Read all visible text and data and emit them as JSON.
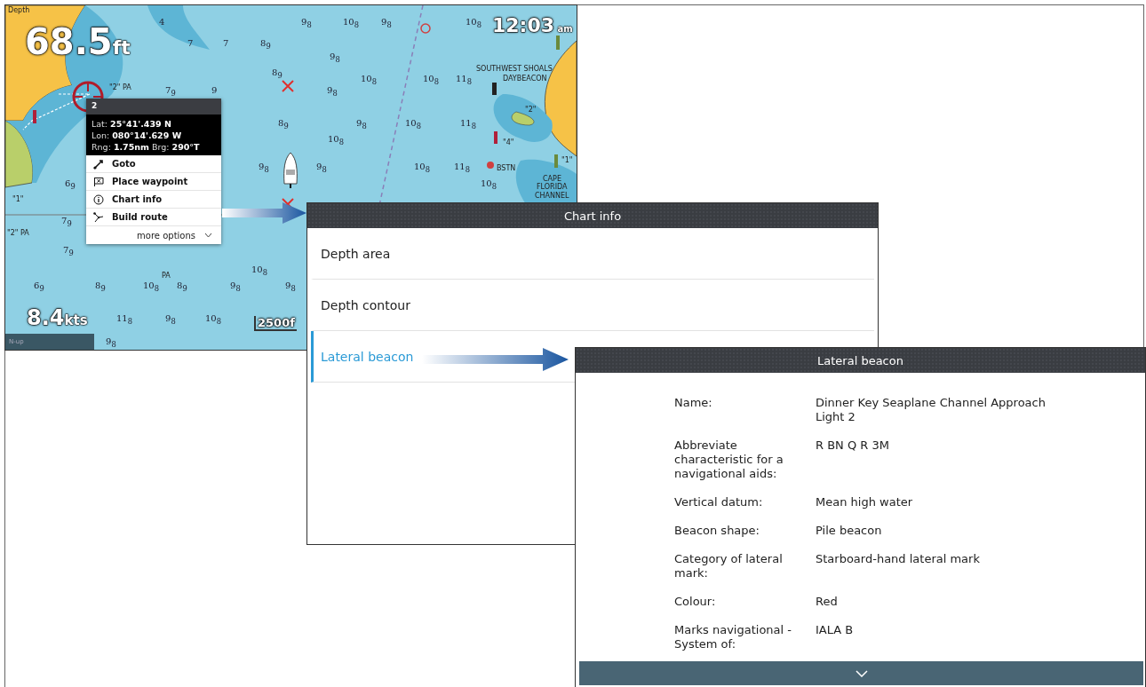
{
  "chart": {
    "depth_label": "Depth",
    "depth": "68.5",
    "depth_unit": "ft",
    "time": "12:03",
    "time_suffix": "am",
    "speed": "8.4",
    "speed_unit": "kts",
    "scale": "2500f",
    "orientation": "N-up",
    "soundings": [
      "4",
      "9$_{8}$",
      "10$_{8}$",
      "9$_{8}$",
      "10$_{8}$",
      "7",
      "7",
      "8$_{9}$",
      "9$_{8}$",
      "8$_{9}$",
      "10$_{8}$",
      "10$_{8}$",
      "11$_{8}$",
      "7$_{9}$",
      "9",
      "9$_{8}$",
      "8$_{9}$",
      "9$_{8}$",
      "10$_{8}$",
      "11$_{8}$",
      "10$_{8}$",
      "9$_{8}$",
      "9$_{8}$",
      "10$_{8}$",
      "11$_{8}$",
      "6$_{9}$",
      "10$_{8}$",
      "7$_{9}$",
      "7$_{9}$",
      "10$_{8}$",
      "6$_{9}$",
      "8$_{9}$",
      "10$_{8}$",
      "8$_{9}$",
      "9$_{8}$",
      "9$_{8}$",
      "11$_{8}$",
      "9$_{8}$",
      "10$_{8}$",
      "9$_{8}$"
    ],
    "place_labels": [
      "SOUTHWEST SHOALS",
      "DAYBEACON",
      "\"2\" PA",
      "\"2\"",
      "\"4\"",
      "\"1\"",
      "BSTN",
      "CAPE",
      "FLORIDA",
      "CHANNEL",
      "\"1\"",
      "\"2\" PA",
      "PA"
    ]
  },
  "context_menu": {
    "title": "2",
    "lines": [
      "Lat: **25°41'.439 N**",
      "Lon: **080°14'.629 W**",
      "Rng: **1.75nm** Brg: **290°T**"
    ],
    "items": [
      {
        "kind": "goto",
        "label": "Goto"
      },
      {
        "kind": "waypoint",
        "label": "Place waypoint"
      },
      {
        "kind": "info",
        "label": "Chart info"
      },
      {
        "kind": "route",
        "label": "Build route"
      }
    ],
    "more": "more options"
  },
  "chart_info": {
    "title": "Chart info",
    "items": [
      {
        "label": "Depth area",
        "selected": false
      },
      {
        "label": "Depth contour",
        "selected": false
      },
      {
        "label": "Lateral beacon",
        "selected": true
      }
    ]
  },
  "detail": {
    "title": "Lateral beacon",
    "rows": [
      {
        "label": "Name:",
        "value": "Dinner Key Seaplane Channel Approach Light 2"
      },
      {
        "label": "Abbreviate characteristic for a navigational aids:",
        "value": "R BN Q R 3M"
      },
      {
        "label": "Vertical datum:",
        "value": "Mean high water"
      },
      {
        "label": "Beacon shape:",
        "value": "Pile beacon"
      },
      {
        "label": "Category of lateral mark:",
        "value": "Starboard-hand lateral mark"
      },
      {
        "label": "Colour:",
        "value": "Red"
      },
      {
        "label": "Marks navigational - System of:",
        "value": "IALA B"
      }
    ]
  }
}
